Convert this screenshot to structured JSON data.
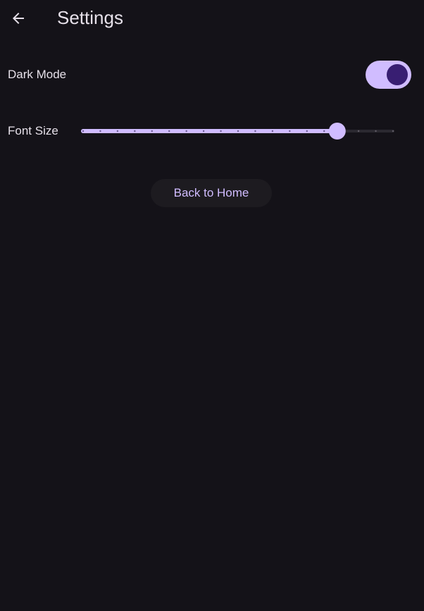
{
  "app_bar": {
    "title": "Settings",
    "back_icon": "arrow-back-icon"
  },
  "settings": {
    "dark_mode": {
      "label": "Dark Mode",
      "enabled": true
    },
    "font_size": {
      "label": "Font Size",
      "value_fraction": 0.82,
      "divisions": 18
    }
  },
  "actions": {
    "back_home_label": "Back to Home"
  },
  "colors": {
    "background": "#141218",
    "on_surface": "#E6E0E9",
    "primary": "#D0BCFF",
    "on_primary": "#381E72",
    "surface_container_low": "#1D1B20",
    "track_inactive": "#2B2930"
  }
}
